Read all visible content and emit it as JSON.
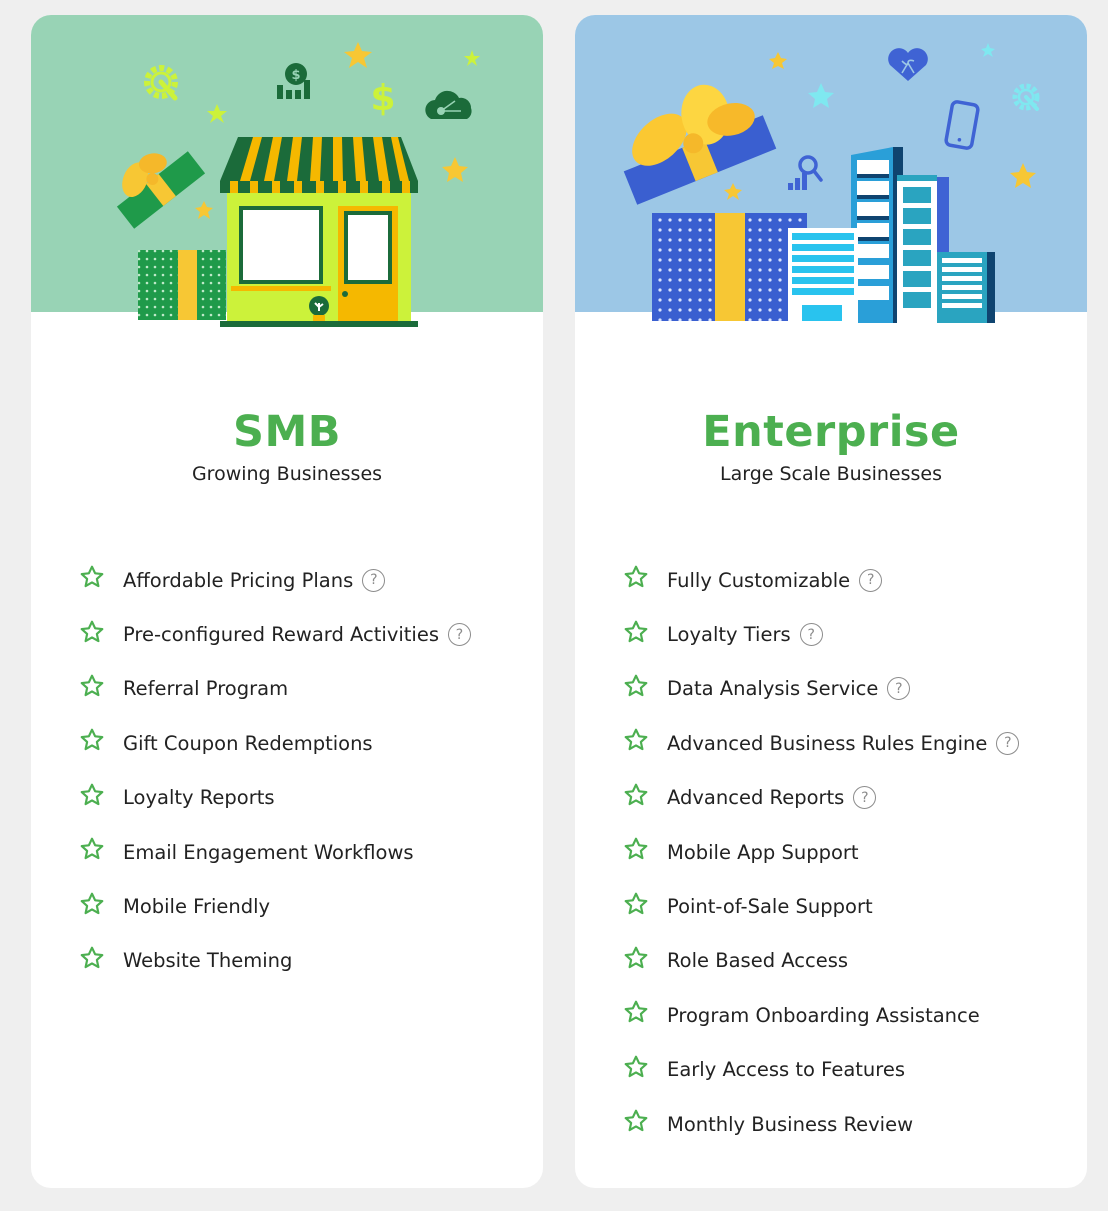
{
  "plans": [
    {
      "name": "SMB",
      "subtitle": "Growing Businesses",
      "hero_illustration": "storefront-with-gift-icon",
      "hero_bg": "#98d3b5",
      "features": [
        {
          "label": "Affordable Pricing Plans",
          "help": true
        },
        {
          "label": "Pre-configured Reward Activities",
          "help": true
        },
        {
          "label": "Referral Program",
          "help": false
        },
        {
          "label": "Gift Coupon Redemptions",
          "help": false
        },
        {
          "label": "Loyalty Reports",
          "help": false
        },
        {
          "label": "Email Engagement Workflows",
          "help": false
        },
        {
          "label": "Mobile Friendly",
          "help": false
        },
        {
          "label": "Website Theming",
          "help": false
        }
      ]
    },
    {
      "name": "Enterprise",
      "subtitle": "Large Scale Businesses",
      "hero_illustration": "city-buildings-with-gift-icon",
      "hero_bg": "#9cc7e6",
      "features": [
        {
          "label": "Fully Customizable",
          "help": true
        },
        {
          "label": "Loyalty Tiers",
          "help": true
        },
        {
          "label": "Data Analysis Service",
          "help": true
        },
        {
          "label": "Advanced Business Rules Engine",
          "help": true
        },
        {
          "label": "Advanced Reports",
          "help": true
        },
        {
          "label": "Mobile App Support",
          "help": false
        },
        {
          "label": "Point-of-Sale Support",
          "help": false
        },
        {
          "label": "Role Based Access",
          "help": false
        },
        {
          "label": "Program Onboarding Assistance",
          "help": false
        },
        {
          "label": "Early Access to Features",
          "help": false
        },
        {
          "label": "Monthly Business Review",
          "help": false
        }
      ]
    }
  ],
  "icons": {
    "feature_bullet": "star-outline-icon",
    "help": "question-circle-icon",
    "help_glyph": "?"
  },
  "colors": {
    "accent_green": "#4caf50",
    "help_gray": "#8c8c8c",
    "page_bg": "#efefef"
  }
}
